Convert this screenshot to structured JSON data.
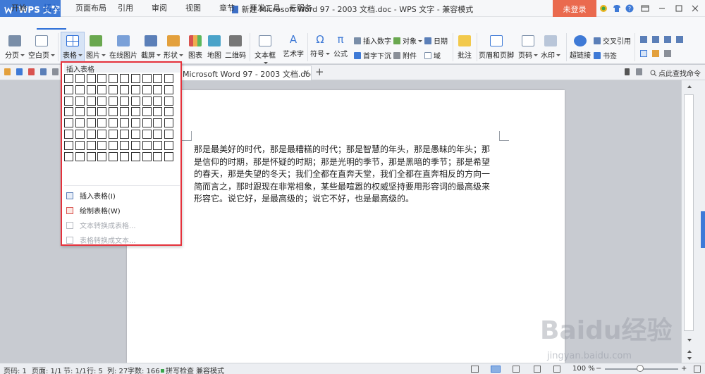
{
  "app": {
    "name": "WPS 文字",
    "login_label": "未登录"
  },
  "window": {
    "title": "新建 Microsoft Word 97 - 2003 文档.doc - WPS 文字 - 兼容模式"
  },
  "menu_tabs": [
    "开始",
    "插入",
    "页面布局",
    "引用",
    "审阅",
    "视图",
    "章节",
    "开发工具",
    "云服务"
  ],
  "active_tab": "插入",
  "ribbon": {
    "page_break": "分页",
    "blank_page": "空白页",
    "table": "表格",
    "picture": "图片",
    "online_picture": "在线图片",
    "screenshot": "截屏",
    "shapes": "形状",
    "chart": "图表",
    "map": "地图",
    "qrcode": "二维码",
    "textbox": "文本框",
    "wordart": "艺术字",
    "symbol": "符号",
    "formula": "公式",
    "insert_number": "插入数字",
    "object": "对象",
    "date": "日期",
    "dropcap": "首字下沉",
    "attachment": "附件",
    "field": "域",
    "comment": "批注",
    "header_footer": "页眉和页脚",
    "page_number": "页码",
    "watermark": "水印",
    "hyperlink": "超链接",
    "cross_ref": "交叉引用",
    "bookmark": "书签"
  },
  "doc_tab": {
    "title": "新建 Microsoft Word 97 - 2003 文档.doc",
    "visible_title": "Microsoft Word 97 - 2003 文档.doc",
    "close": "×",
    "new": "+"
  },
  "find_command": "点此查找命令",
  "dropdown": {
    "title": "插入表格",
    "items": [
      {
        "label": "插入表格(I)",
        "enabled": true
      },
      {
        "label": "绘制表格(W)",
        "enabled": true
      },
      {
        "label": "文本转换成表格...",
        "enabled": false
      },
      {
        "label": "表格转换成文本...",
        "enabled": false
      }
    ]
  },
  "document": {
    "lines": [
      "那是最美好的时代，那是最糟糕的时代；那是智慧的年头，那是愚昧的年头；那",
      "是信仰的时期，那是怀疑的时期；那是光明的季节，那是黑暗的季节；那是希望",
      "的春天，那是失望的冬天；我们全都在直奔天堂，我们全都在直奔相反的方向一",
      "简而言之，那时跟现在非常相象，某些最喧嚣的权威坚持要用形容词的最高级来",
      "形容它。说它好，是最高级的；说它不好，也是最高级的。"
    ]
  },
  "status": {
    "page_code": "页码: 1",
    "pages": "页面: 1/1",
    "section": "节: 1/1",
    "row": "行: 5",
    "column": "列: 27",
    "word_count": "字数: 166",
    "spell_check": "拼写检查",
    "compat_mode": "兼容模式",
    "zoom": "100 %"
  },
  "watermark": {
    "main": "Baidu经验",
    "sub": "jingyan.baidu.com"
  },
  "colors": {
    "accent": "#3f7ad6",
    "login": "#ea6a4e",
    "dropdown_border": "#e5313b"
  }
}
